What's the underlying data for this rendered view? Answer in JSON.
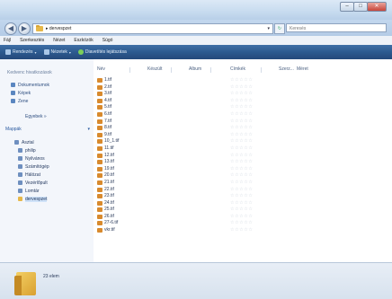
{
  "window": {
    "title_buttons": {
      "minimize": "–",
      "maximize": "□",
      "close": "✕"
    }
  },
  "address": {
    "back_glyph": "◀",
    "forward_glyph": "▶",
    "path": "▸ dervespzet",
    "dropdown_glyph": "▾",
    "refresh_glyph": "↻",
    "search_placeholder": "Keresés"
  },
  "menubar": {
    "items": [
      "Fájl",
      "Szerkesztés",
      "Nézet",
      "Eszközök",
      "Súgó"
    ]
  },
  "toolbar": {
    "organize_label": "Rendezés",
    "views_label": "Nézetek",
    "slideshow_label": "Diavetítés lejátszása"
  },
  "navpane": {
    "favorites_title": "Kedvenc hivatkozások",
    "favorites": [
      {
        "label": "Dokumentumok",
        "icon": "documents-icon"
      },
      {
        "label": "Képek",
        "icon": "pictures-icon"
      },
      {
        "label": "Zene",
        "icon": "music-icon"
      }
    ],
    "more_label": "Egyebek »",
    "folders_title": "Mappák",
    "folders_chevron": "▾",
    "tree": [
      {
        "label": "Asztal",
        "level": 0
      },
      {
        "label": "philip",
        "level": 1
      },
      {
        "label": "Nyilvános",
        "level": 1
      },
      {
        "label": "Számítógép",
        "level": 1
      },
      {
        "label": "Hálózat",
        "level": 1
      },
      {
        "label": "Vezérlőpult",
        "level": 1
      },
      {
        "label": "Lomtár",
        "level": 1
      },
      {
        "label": "dervespzet",
        "level": 1,
        "selected": true
      }
    ]
  },
  "columns": [
    "Név",
    "Készült",
    "Album",
    "Címkék",
    "Szerz...",
    "Méret"
  ],
  "files": [
    "1.tif",
    "2.tif",
    "3.tif",
    "4.tif",
    "5.tif",
    "6.tif",
    "7.tif",
    "8.tif",
    "9.tif",
    "10_1.tif",
    "11.tif",
    "12.tif",
    "13.tif",
    "19.tif",
    "20.tif",
    "21.tif",
    "22.tif",
    "23.tif",
    "24.tif",
    "25.tif",
    "26.tif",
    "27-6.tif",
    "vkr.tif"
  ],
  "rating_glyphs": "☆☆☆☆☆",
  "details": {
    "item_count": "23 elem"
  },
  "colors": {
    "toolbar": "#2d5a8f",
    "titlebar": "#c7dbef",
    "folder": "#e6b84a",
    "file_icon": "#d88a2e"
  }
}
